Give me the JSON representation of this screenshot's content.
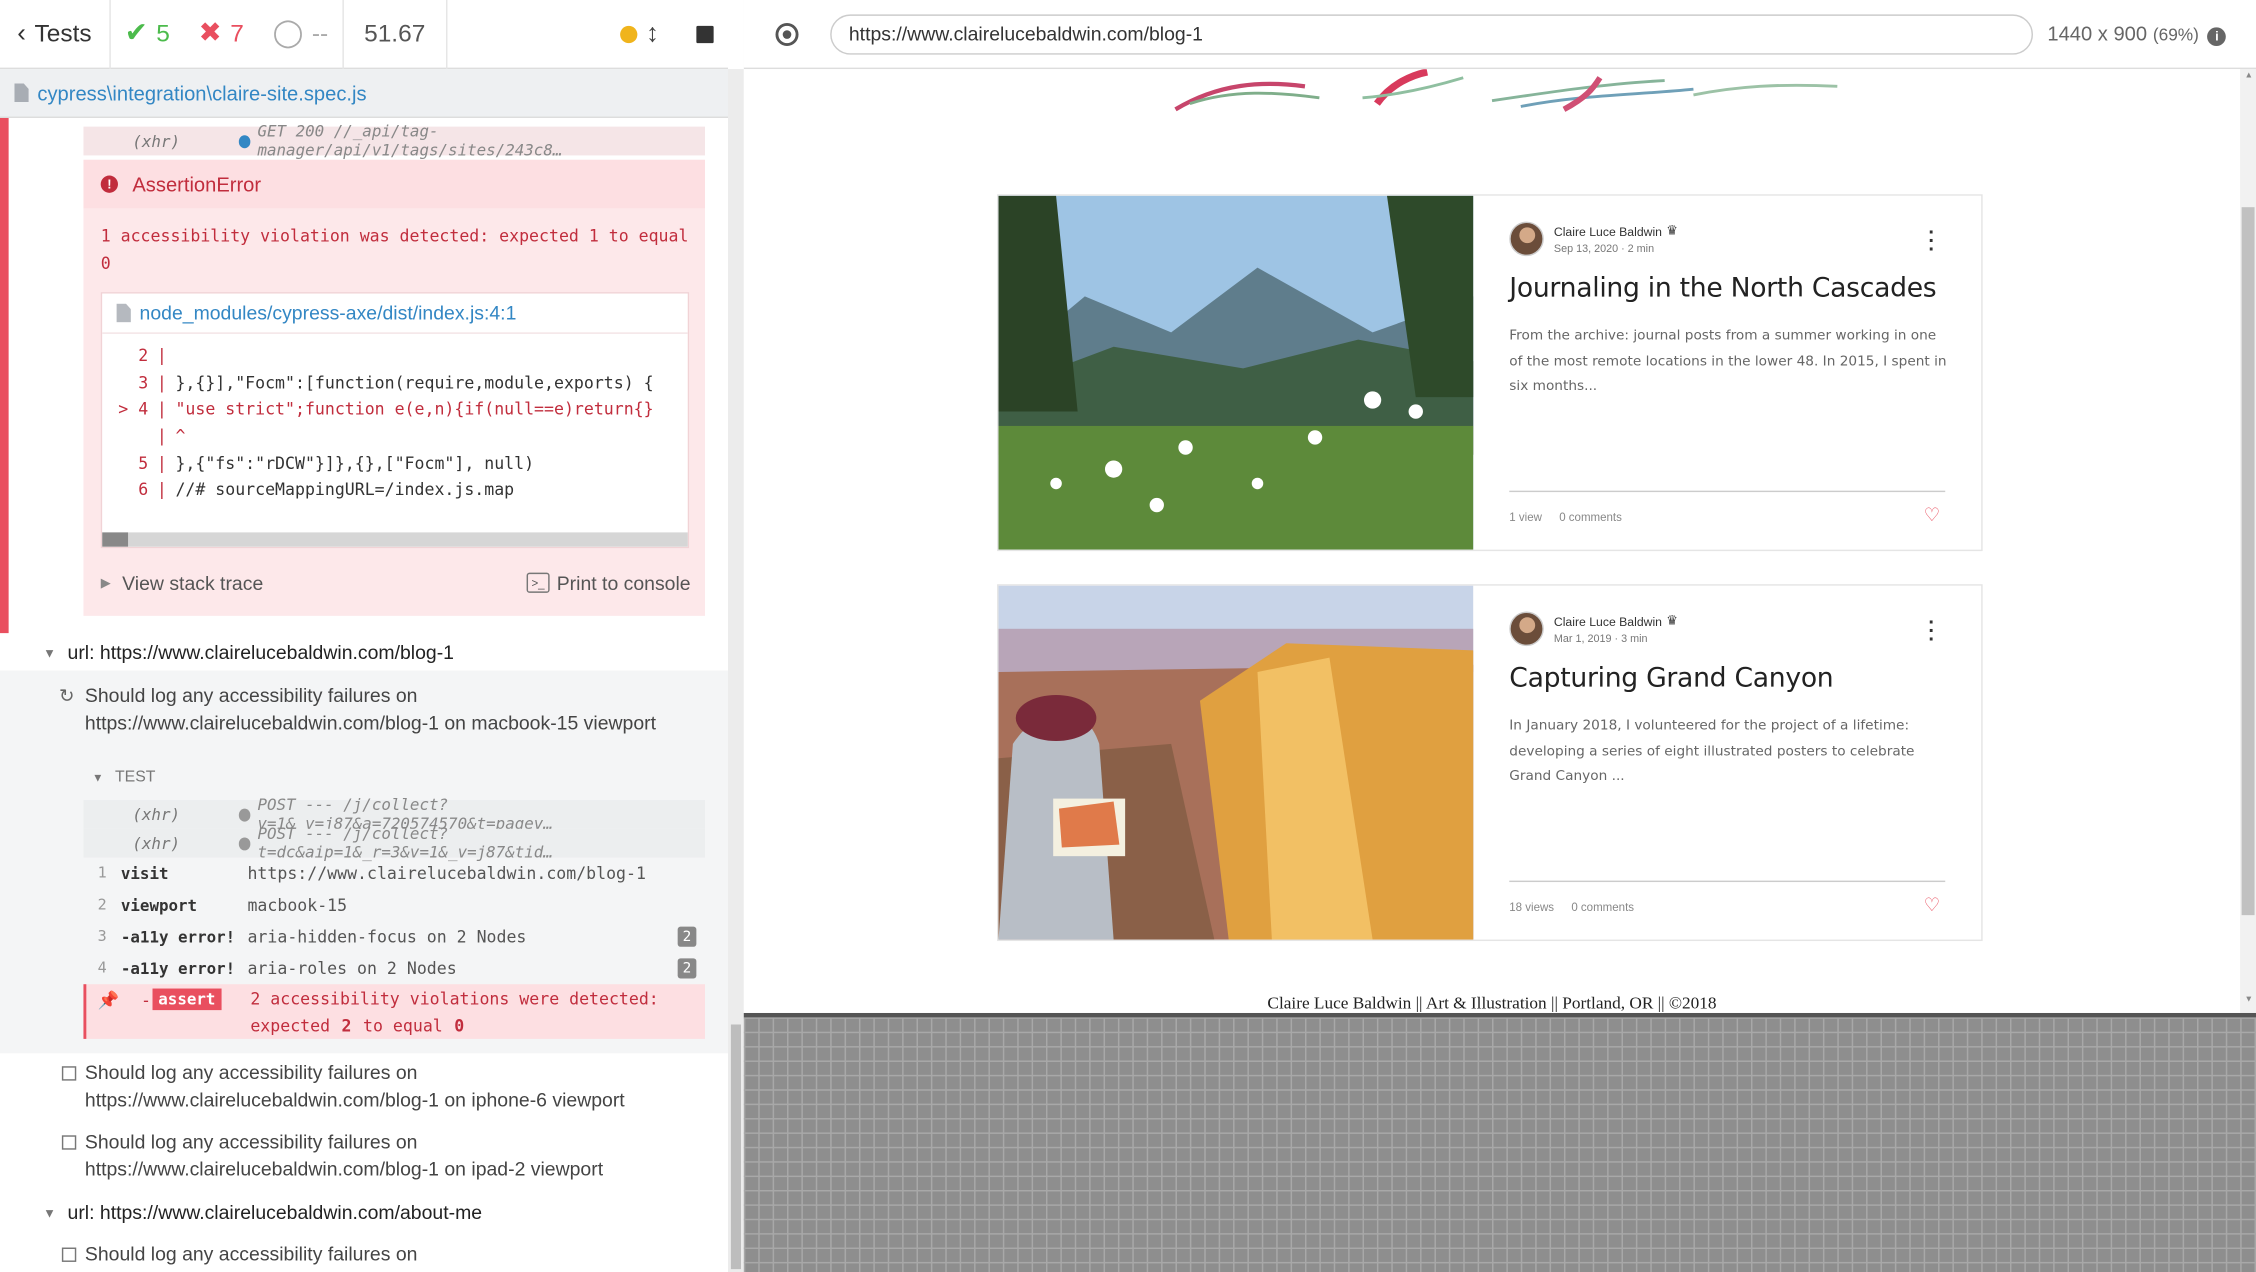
{
  "reporter": {
    "back_label": "Tests",
    "passed": "5",
    "failed": "7",
    "pending": "--",
    "duration": "51.67",
    "spec_path": "cypress\\integration\\claire-site.spec.js"
  },
  "error": {
    "xhr_top": {
      "label": "(xhr)",
      "text": "GET 200 //_api/tag-manager/api/v1/tags/sites/243c8…",
      "dot_color": "#3387c4"
    },
    "title": "AssertionError",
    "message": "1 accessibility violation was detected: expected 1 to equal 0",
    "code_file": "node_modules/cypress-axe/dist/index.js:4:1",
    "code_lines": [
      {
        "ln": "2",
        "code": ""
      },
      {
        "ln": "3",
        "code": "},{}],\"Focm\":[function(require,module,exports) {"
      },
      {
        "ln": "> 4",
        "code": "\"use strict\";function e(e,n){if(null==e)return{}"
      },
      {
        "ln": "",
        "code": "^"
      },
      {
        "ln": "5",
        "code": "},{\"fs\":\"rDCW\"}]},{},[\"Focm\"], null)"
      },
      {
        "ln": "6",
        "code": "//# sourceMappingURL=/index.js.map"
      }
    ],
    "view_stack": "View stack trace",
    "print_console": "Print to console",
    "print_icon": ">_"
  },
  "suite_blog": {
    "title": "url: https://www.clairelucebaldwin.com/blog-1",
    "test_running": "Should log any accessibility failures on https://www.clairelucebaldwin.com/blog-1 on macbook-15 viewport",
    "test_label": "TEST",
    "xhr": [
      {
        "label": "(xhr)",
        "text": "POST --- /j/collect?v=1&_v=j87&a=720574570&t=pagev…"
      },
      {
        "label": "(xhr)",
        "text": "POST --- /j/collect?t=dc&aip=1&_r=3&v=1&_v=j87&tid…"
      }
    ],
    "commands": [
      {
        "num": "1",
        "name": "visit",
        "msg": "https://www.clairelucebaldwin.com/blog-1",
        "count": ""
      },
      {
        "num": "2",
        "name": "viewport",
        "msg": "macbook-15",
        "count": ""
      },
      {
        "num": "3",
        "name": "-a11y error!",
        "msg": "aria-hidden-focus on 2 Nodes",
        "count": "2"
      },
      {
        "num": "4",
        "name": "-a11y error!",
        "msg": "aria-roles on 2 Nodes",
        "count": "2"
      }
    ],
    "assert": {
      "badge": "assert",
      "line1": "2 accessibility violations were detected:",
      "expected_word": "expected",
      "expected_val": "2",
      "to_equal": "to equal",
      "equal_val": "0"
    },
    "test_iphone": "Should log any accessibility failures on https://www.clairelucebaldwin.com/blog-1 on iphone-6 viewport",
    "test_ipad": "Should log any accessibility failures on https://www.clairelucebaldwin.com/blog-1 on ipad-2 viewport"
  },
  "suite_about": {
    "title": "url: https://www.clairelucebaldwin.com/about-me",
    "test_first": "Should log any accessibility failures on"
  },
  "aut": {
    "url": "https://www.clairelucebaldwin.com/blog-1",
    "viewport": "1440 x 900",
    "scale": "(69%)",
    "info_icon": "i"
  },
  "posts": [
    {
      "author": "Claire Luce Baldwin",
      "date": "Sep 13, 2020",
      "read": "2 min",
      "title": "Journaling in the North Cascades",
      "excerpt": "From the archive: journal posts from a summer working in one of the most remote locations in the lower 48. In 2015, I spent in six months...",
      "views": "1 view",
      "comments": "0 comments"
    },
    {
      "author": "Claire Luce Baldwin",
      "date": "Mar 1, 2019",
      "read": "3 min",
      "title": "Capturing Grand Canyon",
      "excerpt": "In January 2018, I volunteered for the project of a lifetime: developing a series of eight illustrated posters to celebrate Grand Canyon ...",
      "views": "18 views",
      "comments": "0 comments"
    }
  ],
  "footer": "Claire Luce Baldwin || Art & Illustration || Portland, OR || ©2018",
  "colors": {
    "pass": "#4cbb4c",
    "fail": "#e94f5f",
    "link": "#3387c4",
    "running": "#f0b41c"
  }
}
